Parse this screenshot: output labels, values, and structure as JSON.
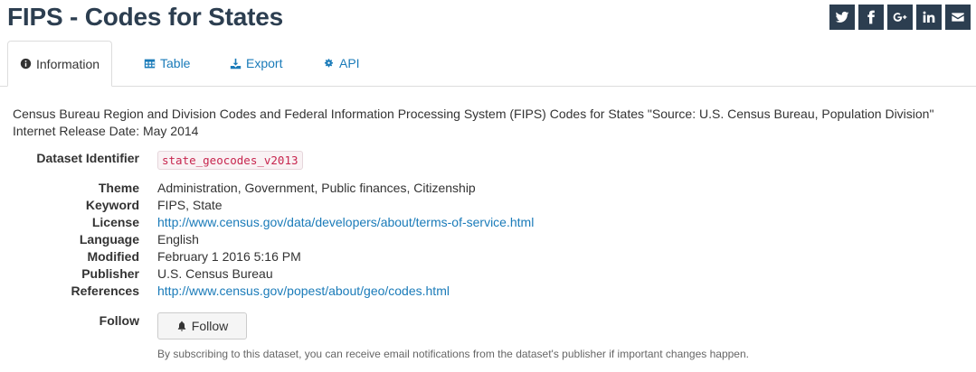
{
  "page": {
    "title": "FIPS - Codes for States"
  },
  "share": [
    {
      "name": "twitter-icon",
      "glyph": "t"
    },
    {
      "name": "facebook-icon",
      "glyph": "f"
    },
    {
      "name": "google-plus-icon",
      "glyph": "G+"
    },
    {
      "name": "linkedin-icon",
      "glyph": "in"
    },
    {
      "name": "email-icon",
      "glyph": "email"
    }
  ],
  "tabs": [
    {
      "label": "Information",
      "icon": "info-circle-icon",
      "active": true
    },
    {
      "label": "Table",
      "icon": "table-icon",
      "active": false
    },
    {
      "label": "Export",
      "icon": "download-icon",
      "active": false
    },
    {
      "label": "API",
      "icon": "cogs-icon",
      "active": false
    }
  ],
  "description": "Census Bureau Region and Division Codes and Federal Information Processing System (FIPS) Codes for States \"Source: U.S. Census Bureau, Population Division\" Internet Release Date: May 2014",
  "identifier": {
    "label": "Dataset Identifier",
    "value": "state_geocodes_v2013"
  },
  "metadata": [
    {
      "label": "Theme",
      "value": "Administration, Government, Public finances, Citizenship",
      "link": false
    },
    {
      "label": "Keyword",
      "value": "FIPS, State",
      "link": false
    },
    {
      "label": "License",
      "value": "http://www.census.gov/data/developers/about/terms-of-service.html",
      "link": true
    },
    {
      "label": "Language",
      "value": "English",
      "link": false
    },
    {
      "label": "Modified",
      "value": "February 1 2016 5:16 PM",
      "link": false
    },
    {
      "label": "Publisher",
      "value": "U.S. Census Bureau",
      "link": false
    },
    {
      "label": "References",
      "value": "http://www.census.gov/popest/about/geo/codes.html",
      "link": true
    }
  ],
  "follow": {
    "label": "Follow",
    "button_label": "Follow",
    "note": "By subscribing to this dataset, you can receive email notifications from the dataset's publisher if important changes happen."
  },
  "colors": {
    "title": "#2c3e50",
    "link": "#1a7bb9",
    "code_text": "#c7254e",
    "code_bg": "#f9f2f4"
  }
}
